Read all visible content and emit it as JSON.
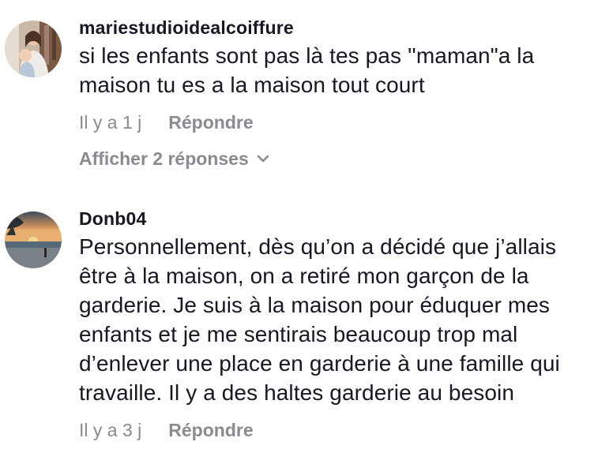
{
  "comments": [
    {
      "username": "mariestudioidealcoiffure",
      "text": "si les enfants sont pas là tes pas ''maman\"a la maison tu es a la maison tout court",
      "time": "Il y a 1 j",
      "reply_label": "Répondre",
      "show_replies_label": "Afficher 2 réponses",
      "avatar_icon": "profile-photo-mother-child"
    },
    {
      "username": "Donb04",
      "text": "Personnellement, dès qu’on a décidé que j’allais être à la maison, on a retiré mon garçon de la garderie. Je suis à la maison pour éduquer mes enfants et je me sentirais beaucoup trop mal d’enlever une place en garderie à une famille qui travaille. Il y a des haltes garderie au besoin",
      "time": "Il y a 3 j",
      "reply_label": "Répondre",
      "avatar_icon": "profile-photo-sunset-beach"
    }
  ],
  "colors": {
    "text": "#161823",
    "meta": "#8a8b91",
    "background": "#ffffff"
  }
}
